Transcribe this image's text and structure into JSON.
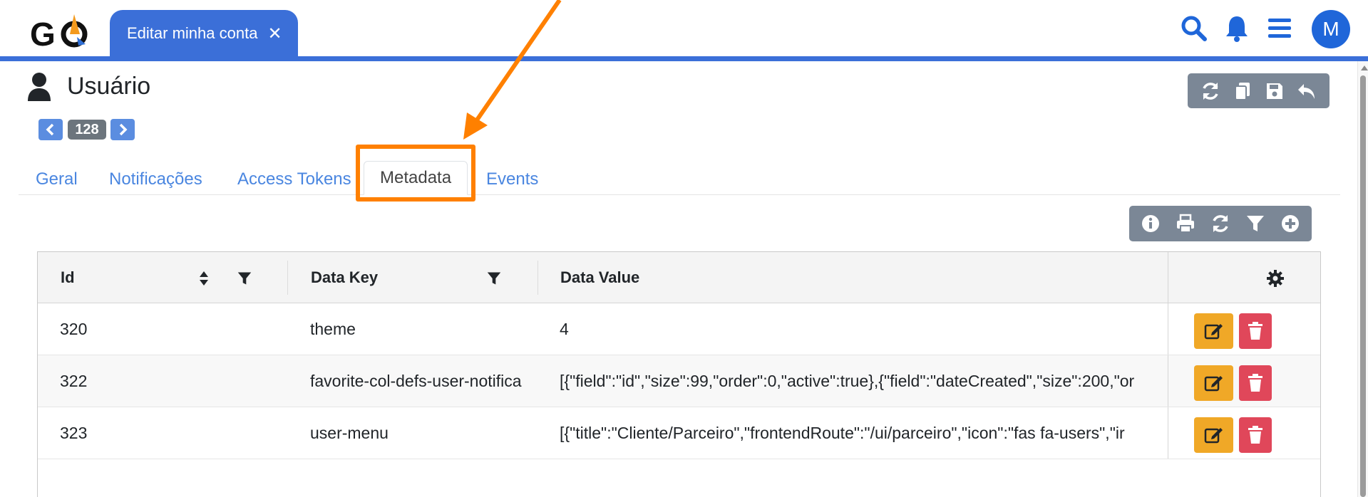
{
  "app": {
    "logo_text": "GO"
  },
  "header": {
    "active_tab_label": "Editar minha conta",
    "close_symbol": "✕",
    "avatar_letter": "M"
  },
  "page": {
    "title": "Usuário",
    "record_count": "128"
  },
  "tabs": [
    {
      "label": "Geral",
      "active": false
    },
    {
      "label": "Notificações",
      "active": false
    },
    {
      "label": "Access Tokens",
      "active": false
    },
    {
      "label": "Metadata",
      "active": true
    },
    {
      "label": "Events",
      "active": false
    }
  ],
  "table": {
    "columns": [
      "Id",
      "Data Key",
      "Data Value"
    ],
    "rows": [
      {
        "id": "320",
        "key": "theme",
        "value": "4"
      },
      {
        "id": "322",
        "key": "favorite-col-defs-user-notifica",
        "value": "[{\"field\":\"id\",\"size\":99,\"order\":0,\"active\":true},{\"field\":\"dateCreated\",\"size\":200,\"or"
      },
      {
        "id": "323",
        "key": "user-menu",
        "value": "[{\"title\":\"Cliente/Parceiro\",\"frontendRoute\":\"/ui/parceiro\",\"icon\":\"fas fa-users\",\"ir"
      }
    ]
  },
  "colors": {
    "brand_blue": "#3b6fd8",
    "highlight_orange": "#ff8000",
    "edit_yellow": "#f0a827",
    "delete_red": "#e0475a",
    "toolbar_gray": "#7b8796"
  }
}
